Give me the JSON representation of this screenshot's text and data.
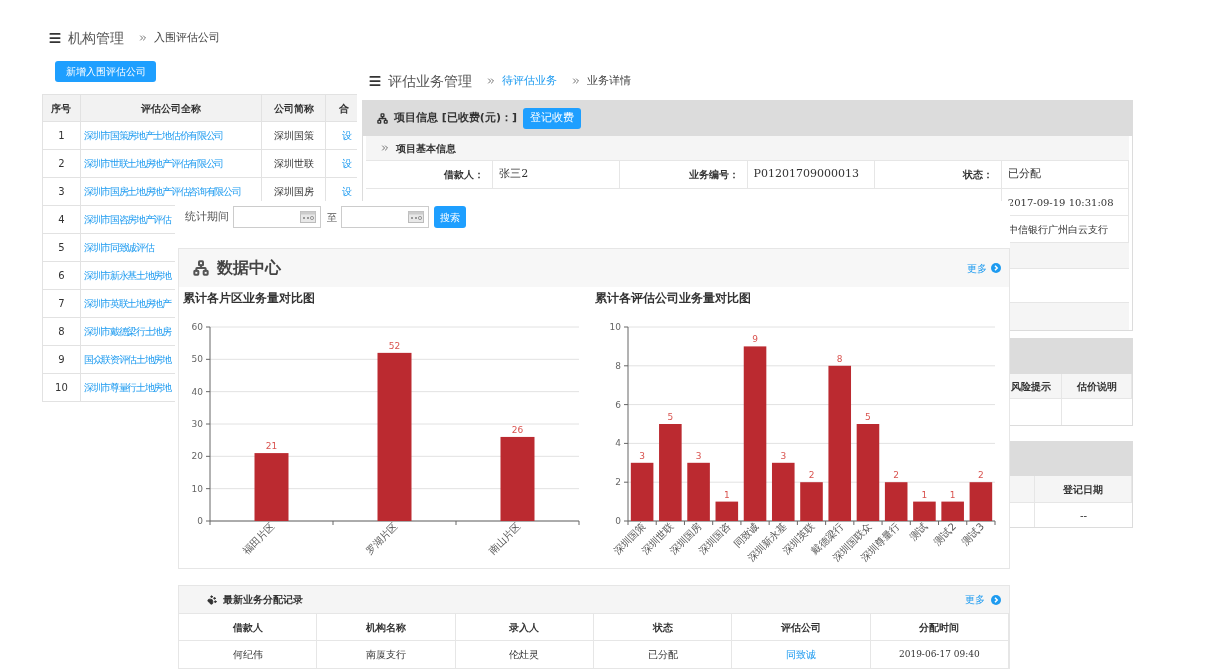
{
  "org_page": {
    "breadcrumb": {
      "title": "机构管理",
      "current": "入围评估公司"
    },
    "add_button": "新增入围评估公司",
    "table": {
      "columns": [
        "序号",
        "评估公司全称",
        "公司简称",
        "合"
      ],
      "rows": [
        {
          "no": "1",
          "name": "深圳市国策房地产土地估价有限公司",
          "short": "深圳国策",
          "action": "设"
        },
        {
          "no": "2",
          "name": "深圳市世联土地房地产评估有限公司",
          "short": "深圳世联",
          "action": "设"
        },
        {
          "no": "3",
          "name": "深圳市国房土地房地产评估咨询有限公司",
          "short": "深圳国房",
          "action": "设"
        },
        {
          "no": "4",
          "name": "深圳市国咨房地产评估"
        },
        {
          "no": "5",
          "name": "深圳市同致诚评估"
        },
        {
          "no": "6",
          "name": "深圳市新永基土地房地"
        },
        {
          "no": "7",
          "name": "深圳市英联土地房地产"
        },
        {
          "no": "8",
          "name": "深圳市戴德梁行土地房"
        },
        {
          "no": "9",
          "name": "国众联资评估土地房地"
        },
        {
          "no": "10",
          "name": "深圳市尊量行土地房地"
        }
      ]
    }
  },
  "business_page": {
    "breadcrumb": {
      "title": "评估业务管理",
      "link": "待评估业务",
      "current": "业务详情"
    },
    "panel_title": "项目信息 [已收费(元)：]",
    "fee_button": "登记收费",
    "section": "项目基本信息",
    "info": [
      {
        "label": "借款人：",
        "value": "张三2"
      },
      {
        "label": "业务编号：",
        "value": "P01201709000013"
      },
      {
        "label": "状态：",
        "value": "已分配"
      }
    ],
    "more_values": [
      "2017-09-19 10:31:08",
      "中信银行广州白云支行"
    ],
    "risk_table": {
      "columns": [
        "风险提示",
        "估价说明"
      ]
    },
    "register_table": {
      "column": "登记日期",
      "value": "--"
    }
  },
  "stats_page": {
    "filter": {
      "label": "统计期间",
      "to": "至",
      "button": "搜索"
    },
    "data_center": {
      "title": "数据中心",
      "more": "更多",
      "charts": [
        {
          "chart_data": {
            "type": "bar",
            "title": "累计各片区业务量对比图",
            "categories": [
              "福田片区",
              "罗湖片区",
              "南山片区"
            ],
            "series": [
              {
                "color": "#bb2a30",
                "values": [
                  21,
                  52,
                  26
                ]
              }
            ],
            "ylim": [
              0,
              60
            ],
            "yticks": [
              0,
              10,
              20,
              30,
              40,
              50,
              60
            ],
            "grid": true,
            "data_labels": true
          }
        },
        {
          "chart_data": {
            "type": "bar",
            "title": "累计各评估公司业务量对比图",
            "categories": [
              "深圳国策",
              "深圳世联",
              "深圳国房",
              "深圳国咨",
              "同致诚",
              "深圳新永基",
              "深圳英联",
              "戴德梁行",
              "深圳国联众",
              "深圳尊量行",
              "测试",
              "测试2",
              "测试3"
            ],
            "series": [
              {
                "color": "#bb2a30",
                "values": [
                  3,
                  5,
                  3,
                  1,
                  9,
                  3,
                  2,
                  8,
                  5,
                  2,
                  1,
                  1,
                  2
                ]
              }
            ],
            "ylim": [
              0,
              10
            ],
            "yticks": [
              0,
              2,
              4,
              6,
              8,
              10
            ],
            "grid": true,
            "data_labels": true
          }
        }
      ]
    },
    "assignments": {
      "title": "最新业务分配记录",
      "more": "更多",
      "columns": [
        "借款人",
        "机构名称",
        "录入人",
        "状态",
        "评估公司",
        "分配时间"
      ],
      "rows": [
        {
          "borrower": "何纪伟",
          "branch": "南厦支行",
          "entered_by": "伦灶灵",
          "status": "已分配",
          "company": "同致诚",
          "time": "2019-06-17 09:40"
        }
      ]
    }
  }
}
